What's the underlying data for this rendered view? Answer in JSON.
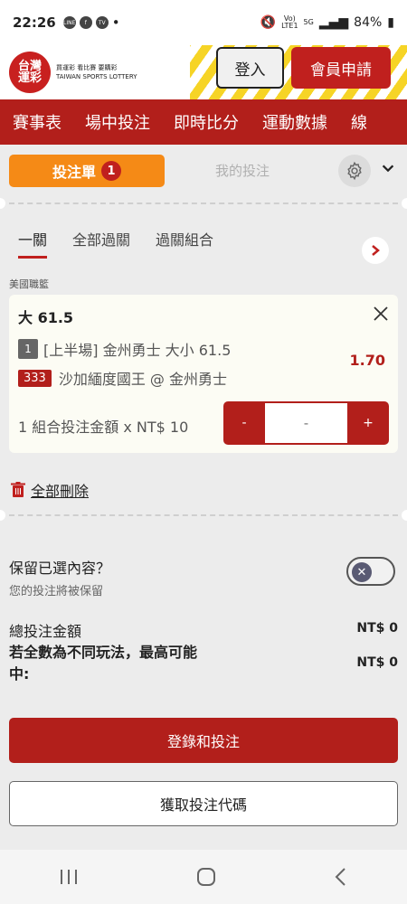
{
  "status_bar": {
    "time": "22:26",
    "carrier_icons": [
      "LINE",
      "f",
      "TV"
    ],
    "network": "5G",
    "battery": "84%"
  },
  "header": {
    "logo_name": "台灣運彩",
    "logo_tagline": "買運彩 看比賽 要購彩",
    "logo_english": "TAIWAN SPORTS LOTTERY",
    "login_label": "登入",
    "register_label": "會員申請"
  },
  "nav": {
    "items": [
      "賽事表",
      "場中投注",
      "即時比分",
      "運動數據",
      "線"
    ]
  },
  "slip": {
    "tab_slip_label": "投注單",
    "tab_slip_count": "1",
    "tab_mine_label": "我的投注",
    "subtabs": [
      "一關",
      "全部過關",
      "過關組合"
    ],
    "league": "美國職籃",
    "selection": {
      "title": "大 61.5",
      "leg_number": "1",
      "market": "[上半場] 金州勇士 大小 61.5",
      "game_code": "333",
      "matchup": "沙加緬度國王 @ 金州勇士",
      "odds": "1.70"
    },
    "stake_label": "1 組合投注金額 x NT$ 10",
    "stepper": {
      "minus": "-",
      "value": "-",
      "plus": "+"
    },
    "delete_all_label": "全部刪除",
    "keep_question": "保留已選內容？",
    "keep_sub": "您的投注將被保留",
    "total_label": "總投注金額",
    "total_value": "NT$ 0",
    "max_win_label": "若全數為不同玩法，最高可能中:",
    "max_win_value": "NT$ 0",
    "submit_label": "登錄和投注",
    "code_label": "獲取投注代碼"
  },
  "colors": {
    "brand_red": "#b21f1b",
    "orange": "#f58a16",
    "yellow": "#f6d21a"
  }
}
